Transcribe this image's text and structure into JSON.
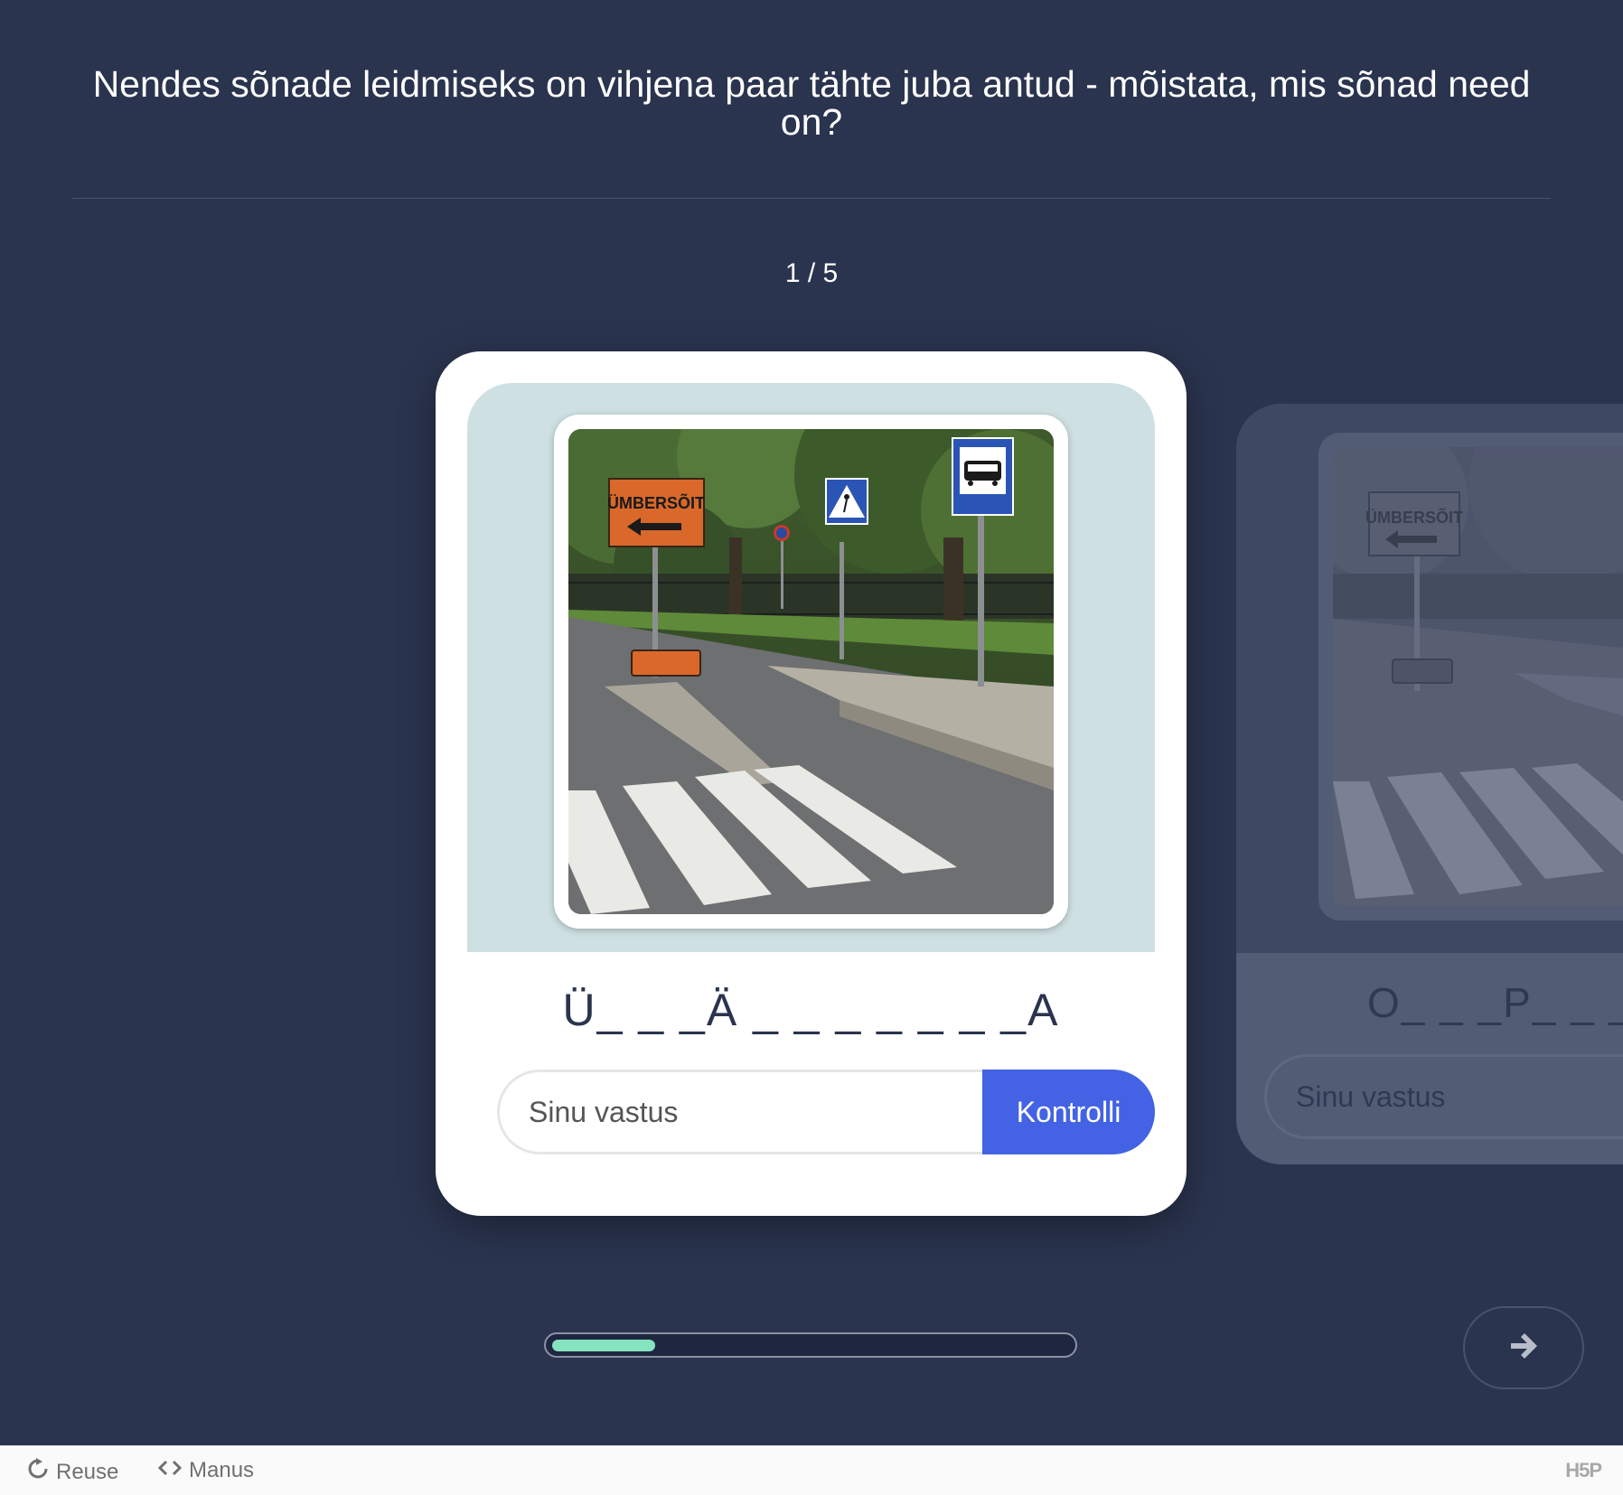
{
  "question": {
    "title": "Nendes sõnade leidmiseks on vihjena paar tähte juba antud - mõistata, mis sõnad need on?"
  },
  "navigation": {
    "counter": "1 / 5",
    "progress_fraction": 0.2
  },
  "current_card": {
    "image": {
      "sign_text": "ÜMBERSÕIT"
    },
    "word_hint": "Ü_ _ _Ä _ _ _ _ _ _ _A",
    "input_placeholder": "Sinu vastus",
    "check_label": "Kontrolli"
  },
  "next_card": {
    "image": {
      "sign_text": "ÜMBERSÕIT"
    },
    "word_hint": "O_ _ _P_ _ _",
    "input_placeholder": "Sinu vastus"
  },
  "footer": {
    "reuse_label": "Reuse",
    "embed_label": "Manus",
    "logo_text": "H5P"
  },
  "colors": {
    "background": "#2a344e",
    "accent_button": "#4363e4",
    "progress_fill": "#86e3c0",
    "card_media_bg": "#cfe0e3"
  }
}
